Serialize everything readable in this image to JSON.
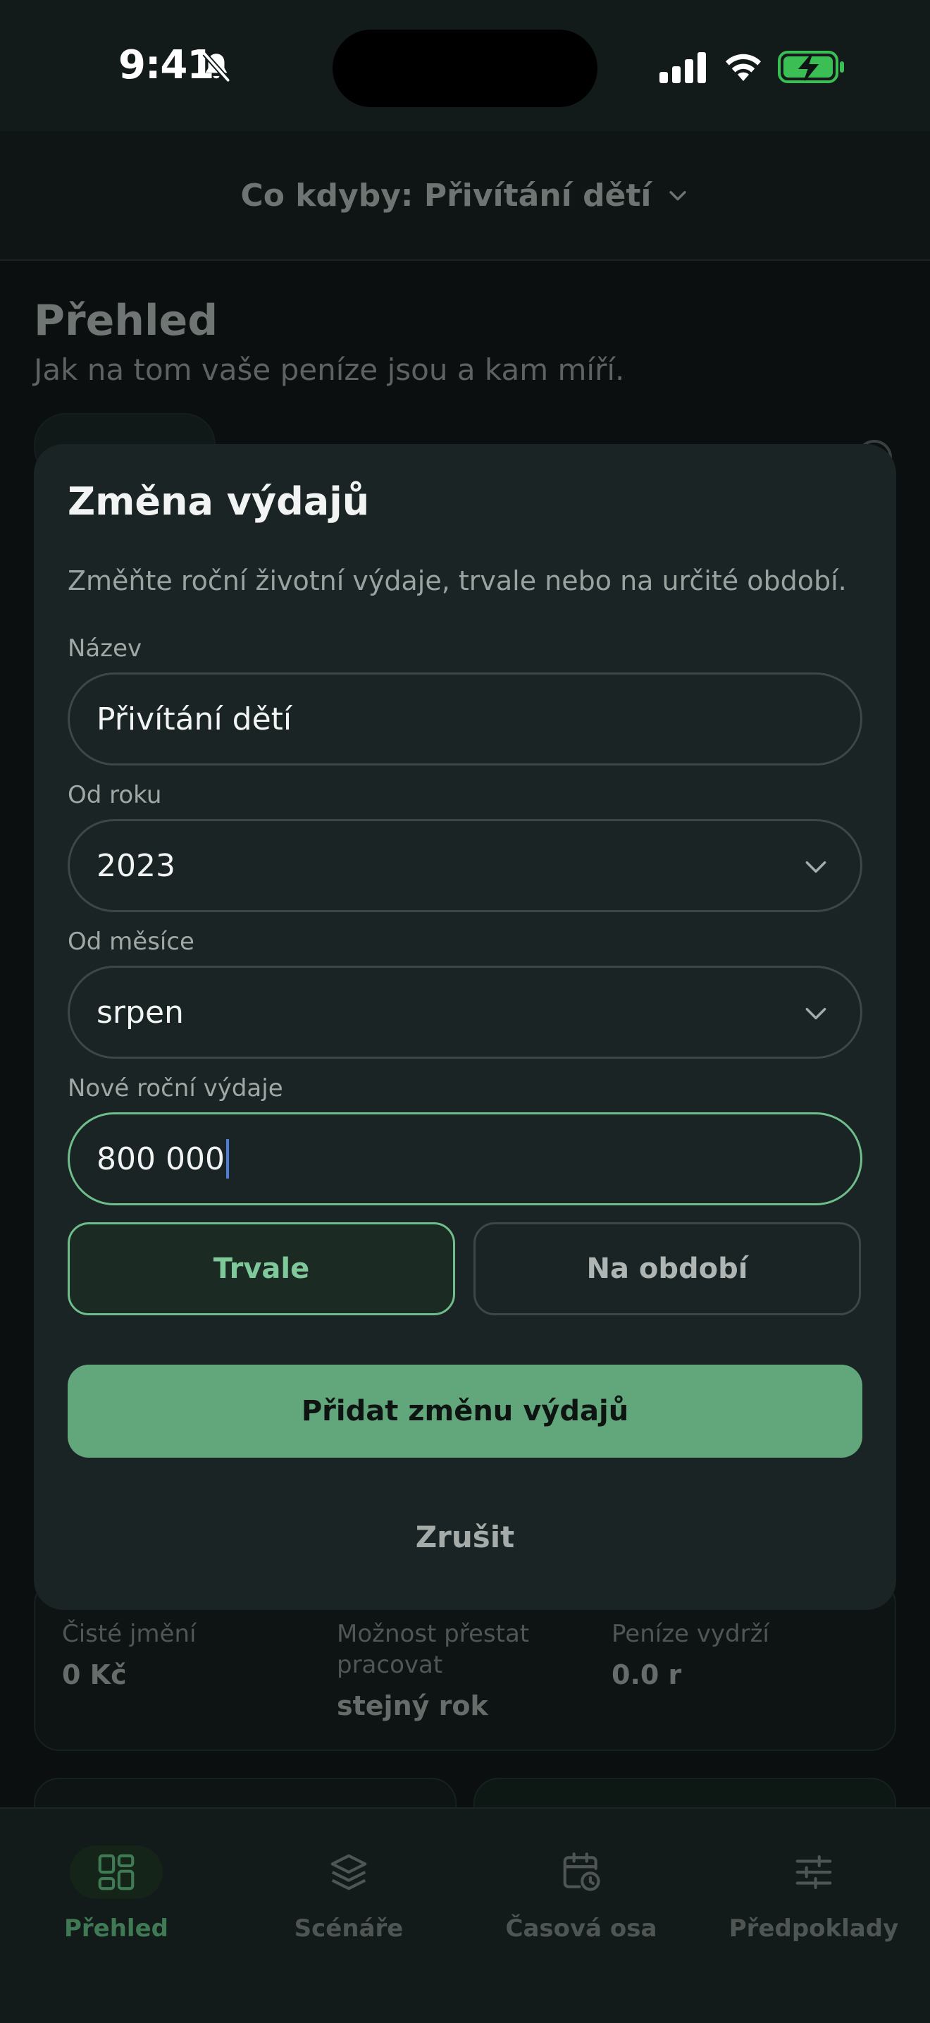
{
  "status_bar": {
    "time": "9:41",
    "icons": [
      "bell-slash-icon",
      "cellular-signal-icon",
      "wifi-icon",
      "battery-charging-icon"
    ]
  },
  "header": {
    "scenario_title": "Co kdyby: Přivítání dětí",
    "chevron_icon": "chevron-down-icon"
  },
  "page": {
    "title": "Přehled",
    "subtitle": "Jak na tom vaše peníze jsou a kam míří."
  },
  "summary": {
    "stats": [
      {
        "label": "Čisté jmění",
        "value": "0 Kč"
      },
      {
        "label": "Možnost přestat pracovat",
        "value": "stejný rok"
      },
      {
        "label": "Peníze vydrží",
        "value": "0.0 r"
      }
    ]
  },
  "modal": {
    "title": "Změna výdajů",
    "description": "Změňte roční životní výdaje, trvale nebo na určité období.",
    "fields": {
      "name": {
        "label": "Název",
        "value": "Přivítání dětí"
      },
      "from_year": {
        "label": "Od roku",
        "value": "2023"
      },
      "from_month": {
        "label": "Od měsíce",
        "value": "srpen"
      },
      "new_expenses": {
        "label": "Nové roční výdaje",
        "value": "800 000"
      }
    },
    "duration_options": {
      "permanent": "Trvale",
      "period": "Na období",
      "selected": "permanent"
    },
    "submit_label": "Přidat změnu výdajů",
    "cancel_label": "Zrušit"
  },
  "tabs": [
    {
      "label": "Přehled",
      "icon": "grid-icon",
      "active": true
    },
    {
      "label": "Scénáře",
      "icon": "layers-icon",
      "active": false
    },
    {
      "label": "Časová osa",
      "icon": "calendar-clock-icon",
      "active": false
    },
    {
      "label": "Předpoklady",
      "icon": "sliders-icon",
      "active": false
    }
  ],
  "colors": {
    "accent": "#62a67c",
    "accent_border": "#6fbd8b",
    "modal_bg": "#1a2424",
    "page_bg": "#0b0f0f",
    "caret": "#4f7ddc"
  }
}
